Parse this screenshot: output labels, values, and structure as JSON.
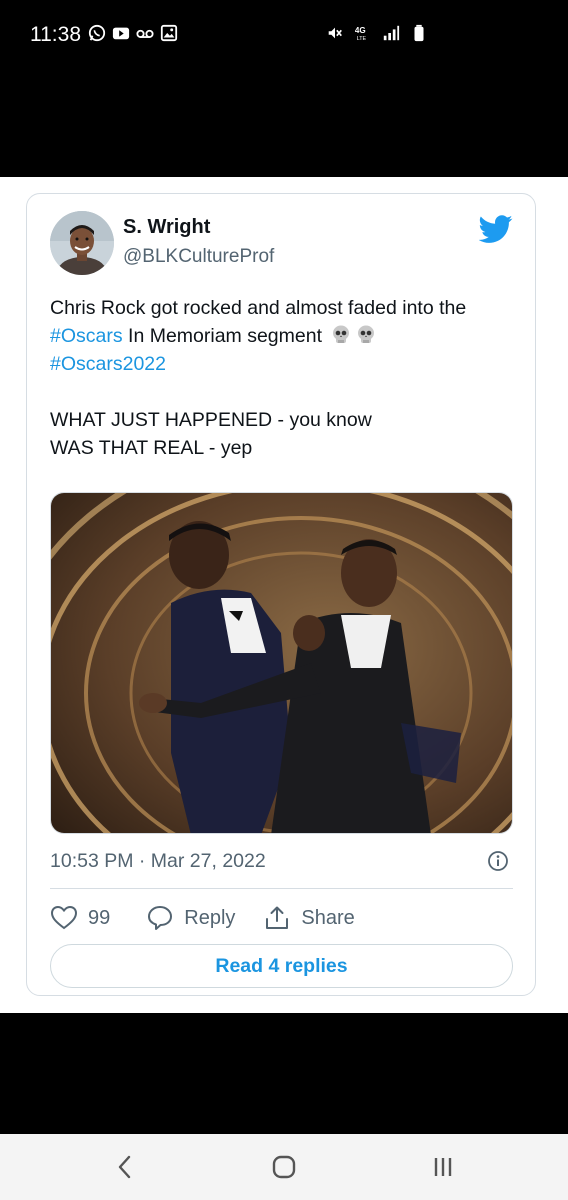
{
  "status_bar": {
    "time": "11:38",
    "left_icons": [
      "whatsapp-icon",
      "youtube-icon",
      "voicemail-icon",
      "gallery-icon"
    ],
    "right_icons": [
      "mute-icon",
      "4g-lte-icon",
      "signal-icon",
      "battery-icon"
    ]
  },
  "tweet": {
    "display_name": "S. Wright",
    "handle": "@BLKCultureProf",
    "text_part1": "Chris Rock got rocked and almost faded into the",
    "hashtag1": "#Oscars",
    "text_part2": " In Memoriam segment",
    "hashtag2": "#Oscars2022",
    "line4": "WHAT JUST HAPPENED - you know",
    "line5": "WAS THAT REAL - yep",
    "timestamp": "10:53 PM · Mar 27, 2022",
    "like_count": "99",
    "reply_label": "Reply",
    "share_label": "Share",
    "read_replies_label": "Read 4 replies"
  },
  "colors": {
    "accent": "#1b95e0",
    "secondary_text": "#536471",
    "border": "#d6dde3"
  }
}
